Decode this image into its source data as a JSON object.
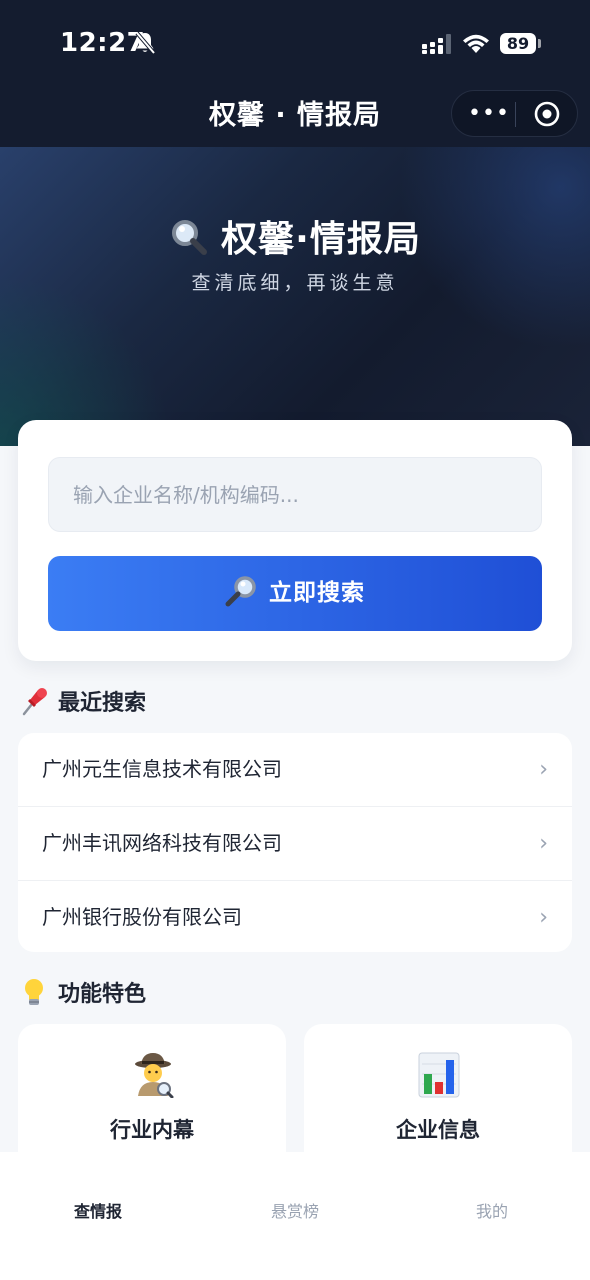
{
  "status_bar": {
    "time": "12:27",
    "battery": "89"
  },
  "nav": {
    "title": "权馨 · 情报局",
    "capsule_more": "•••"
  },
  "hero": {
    "title": "权馨·情报局",
    "subtitle": "查清底细，再谈生意"
  },
  "search": {
    "placeholder": "输入企业名称/机构编码...",
    "button_label": "立即搜索"
  },
  "recent": {
    "heading": "最近搜索",
    "items": [
      {
        "name": "广州元生信息技术有限公司"
      },
      {
        "name": "广州丰讯网络科技有限公司"
      },
      {
        "name": "广州银行股份有限公司"
      }
    ],
    "chevron": "›"
  },
  "features": {
    "heading": "功能特色",
    "cards": [
      {
        "label": "行业内幕",
        "icon": "detective-icon"
      },
      {
        "label": "企业信息",
        "icon": "bar-chart-icon"
      }
    ]
  },
  "tabbar": {
    "tabs": [
      {
        "label": "查情报",
        "active": true
      },
      {
        "label": "悬赏榜",
        "active": false
      },
      {
        "label": "我的",
        "active": false
      }
    ]
  },
  "colors": {
    "header_bg": "#141c2f",
    "primary": "#2f63e6",
    "page_bg": "#f5f7fa"
  }
}
